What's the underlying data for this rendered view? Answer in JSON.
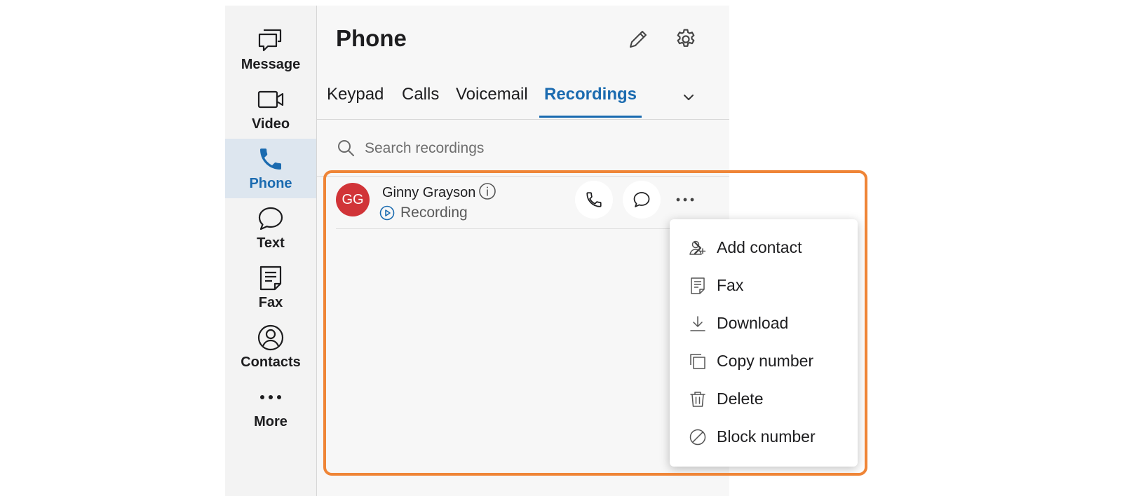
{
  "nav": {
    "items": [
      {
        "label": "Message",
        "icon": "message-icon"
      },
      {
        "label": "Video",
        "icon": "video-icon"
      },
      {
        "label": "Phone",
        "icon": "phone-icon",
        "active": true
      },
      {
        "label": "Text",
        "icon": "text-bubble-icon"
      },
      {
        "label": "Fax",
        "icon": "fax-icon"
      },
      {
        "label": "Contacts",
        "icon": "contacts-icon"
      },
      {
        "label": "More",
        "icon": "more-dots-icon"
      }
    ]
  },
  "header": {
    "title": "Phone",
    "edit_icon": "pencil-icon",
    "settings_icon": "gear-icon"
  },
  "tabs": [
    {
      "label": "Keypad"
    },
    {
      "label": "Calls"
    },
    {
      "label": "Voicemail"
    },
    {
      "label": "Recordings",
      "active": true
    }
  ],
  "search": {
    "placeholder": "Search recordings"
  },
  "recording": {
    "initials": "GG",
    "name": "Ginny Grayson",
    "status": "Recording"
  },
  "menu": {
    "items": [
      {
        "label": "Add contact",
        "icon": "add-person-icon",
        "has_submenu": true
      },
      {
        "label": "Fax",
        "icon": "fax-icon"
      },
      {
        "label": "Download",
        "icon": "download-icon"
      },
      {
        "label": "Copy number",
        "icon": "copy-icon"
      },
      {
        "label": "Delete",
        "icon": "trash-icon"
      },
      {
        "label": "Block number",
        "icon": "block-icon"
      }
    ]
  },
  "colors": {
    "accent": "#1b6bb0",
    "avatar": "#d13438",
    "highlight": "#ef8537",
    "active_nav_bg": "#dde6ef"
  }
}
